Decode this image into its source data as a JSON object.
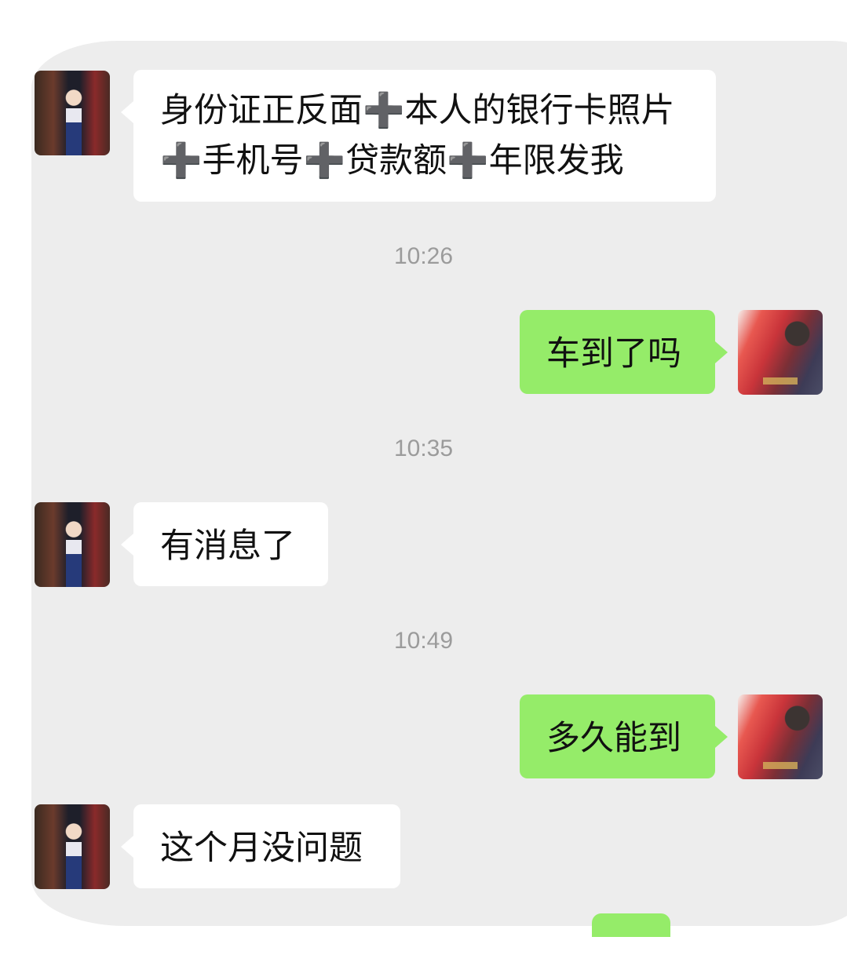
{
  "messages": [
    {
      "side": "in",
      "lines": [
        "身份证正反面➕本人的银行卡照片",
        "➕手机号➕贷款额➕年限发我"
      ]
    },
    {
      "timestamp": "10:26"
    },
    {
      "side": "out",
      "text": "车到了吗"
    },
    {
      "timestamp": "10:35"
    },
    {
      "side": "in",
      "text": "有消息了"
    },
    {
      "timestamp": "10:49"
    },
    {
      "side": "out",
      "text": "多久能到"
    },
    {
      "side": "in",
      "text": "这个月没问题"
    }
  ],
  "colors": {
    "chat_background": "#ededed",
    "incoming_bubble": "#ffffff",
    "outgoing_bubble": "#95ec69",
    "timestamp_text": "#9b9b9b"
  },
  "icons": {
    "other_avatar": "avatar-man-in-suit",
    "self_avatar": "avatar-red-illustration"
  }
}
